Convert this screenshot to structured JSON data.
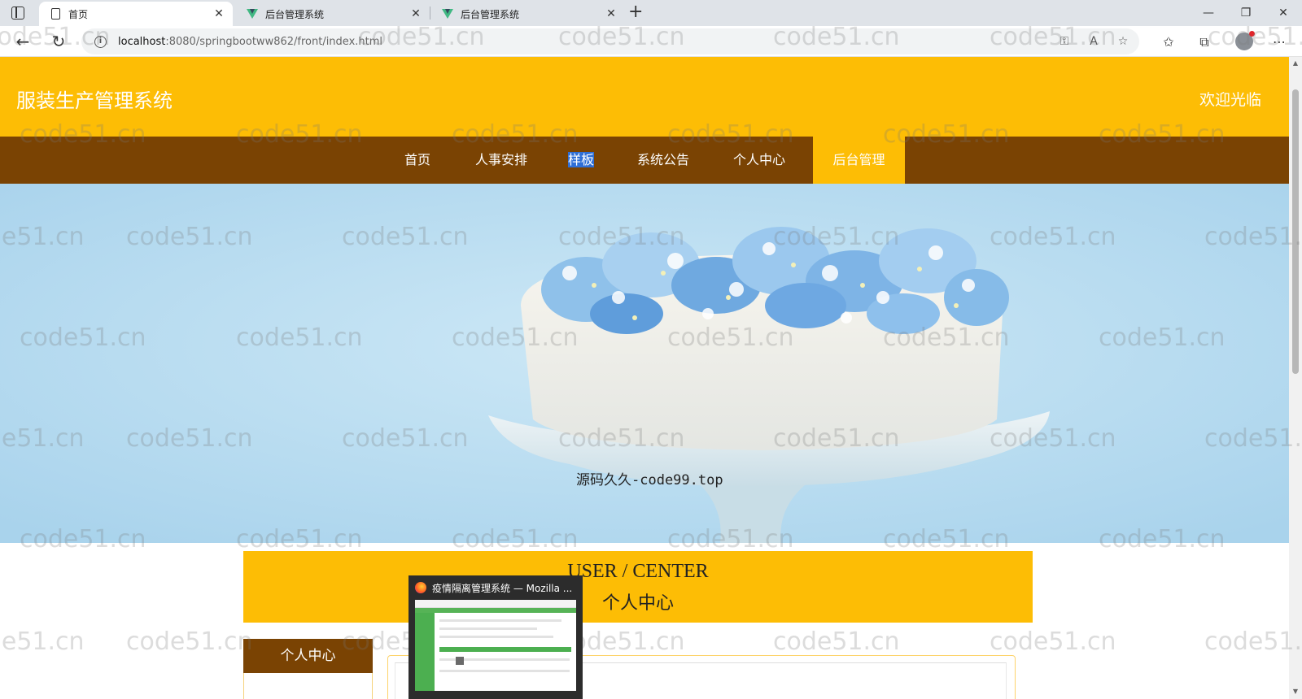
{
  "browser": {
    "tabs": [
      {
        "title": "首页",
        "icon": "document-icon",
        "active": true
      },
      {
        "title": "后台管理系统",
        "icon": "vue-logo-icon",
        "active": false
      },
      {
        "title": "后台管理系统",
        "icon": "vue-logo-icon",
        "active": false
      }
    ],
    "url_host": "localhost",
    "url_rest": ":8080/springbootww862/front/index.html"
  },
  "header": {
    "site_title": "服装生产管理系统",
    "welcome": "欢迎光临"
  },
  "menu": {
    "items": [
      {
        "label": "首页"
      },
      {
        "label": "人事安排"
      },
      {
        "label": "样板"
      },
      {
        "label": "系统公告"
      },
      {
        "label": "个人中心"
      },
      {
        "label": "后台管理",
        "active": true
      }
    ],
    "colors": {
      "bar": "#7a4303",
      "active": "#fdbd05"
    }
  },
  "banner": {
    "caption": "源码久久-code99.top",
    "slide_count": 3,
    "active_slide": 2
  },
  "section": {
    "title_en": "USER / CENTER",
    "title_cn": "个人中心"
  },
  "sidebar": {
    "tab_label": "个人中心"
  },
  "taskbar_preview": {
    "title": "疫情隔离管理系统 — Mozilla ..."
  },
  "watermark": {
    "text": "code51.cn"
  },
  "theme": {
    "primary": "#fdbd05",
    "secondary": "#7a4303"
  }
}
